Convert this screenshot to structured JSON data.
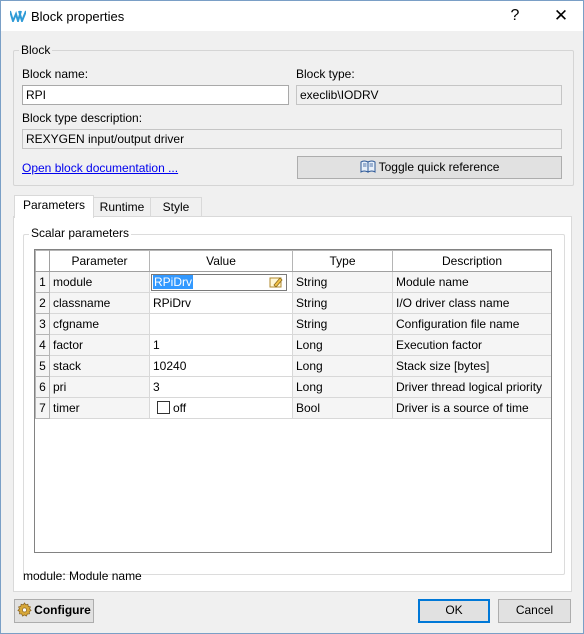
{
  "window": {
    "title": "Block properties",
    "help_glyph": "?",
    "close_glyph": "✕"
  },
  "block_group": {
    "title": "Block",
    "name_label": "Block name:",
    "name_value": "RPI",
    "type_label": "Block type:",
    "type_value": "execlib\\IODRV",
    "desc_label": "Block type description:",
    "desc_value": "REXYGEN input/output driver",
    "doc_link": "Open block documentation ...",
    "quickref_button": "Toggle quick reference"
  },
  "tabs": [
    {
      "label": "Parameters",
      "active": true
    },
    {
      "label": "Runtime",
      "active": false
    },
    {
      "label": "Style",
      "active": false
    }
  ],
  "scalar_group": {
    "title": "Scalar parameters",
    "columns": [
      "Parameter",
      "Value",
      "Type",
      "Description"
    ],
    "rows": [
      {
        "num": "1",
        "parameter": "module",
        "value": "RPiDrv",
        "type": "String",
        "description": "Module name",
        "editing": true
      },
      {
        "num": "2",
        "parameter": "classname",
        "value": "RPiDrv",
        "type": "String",
        "description": "I/O driver class name"
      },
      {
        "num": "3",
        "parameter": "cfgname",
        "value": "",
        "type": "String",
        "description": "Configuration file name"
      },
      {
        "num": "4",
        "parameter": "factor",
        "value": "1",
        "type": "Long",
        "description": "Execution factor"
      },
      {
        "num": "5",
        "parameter": "stack",
        "value": "10240",
        "type": "Long",
        "description": "Stack size [bytes]"
      },
      {
        "num": "6",
        "parameter": "pri",
        "value": "3",
        "type": "Long",
        "description": "Driver thread logical priority"
      },
      {
        "num": "7",
        "parameter": "timer",
        "value": "off",
        "type": "Bool",
        "description": "Driver is a source of time",
        "checkbox": true,
        "checked": false
      }
    ]
  },
  "status_text": "module: Module name",
  "footer": {
    "configure_button": "Configure",
    "ok_button": "OK",
    "cancel_button": "Cancel"
  },
  "colors": {
    "accent": "#0078d7",
    "link": "#0000ee",
    "selection": "#3399ff",
    "logo": "#2f9bd6"
  }
}
